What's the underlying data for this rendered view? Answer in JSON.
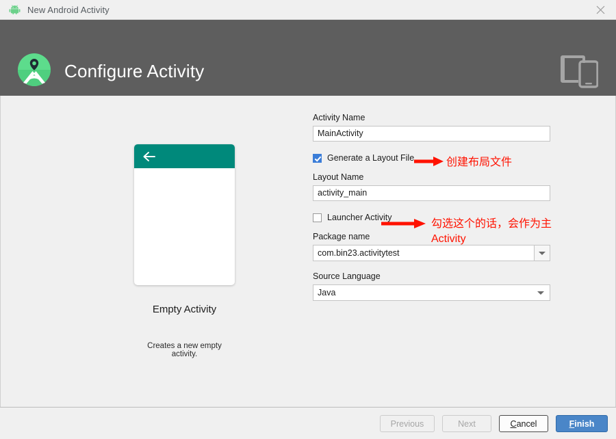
{
  "window": {
    "title": "New Android Activity",
    "android_icon": "android-robot-icon",
    "close_icon": "close-icon"
  },
  "header": {
    "title": "Configure Activity",
    "logo_icon": "android-studio-logo-icon",
    "device_icon": "tablet-and-phone-icon"
  },
  "preview": {
    "back_icon": "back-arrow-icon",
    "template_name": "Empty Activity",
    "description": "Creates a new empty activity.",
    "accent_color": "#00897b"
  },
  "form": {
    "activity_name": {
      "label": "Activity Name",
      "value": "MainActivity"
    },
    "generate_layout": {
      "label": "Generate a Layout File",
      "checked": true
    },
    "layout_name": {
      "label": "Layout Name",
      "value": "activity_main"
    },
    "launcher_activity": {
      "label": "Launcher Activity",
      "checked": false
    },
    "package_name": {
      "label": "Package name",
      "value": "com.bin23.activitytest",
      "dropdown_icon": "chevron-down-icon"
    },
    "source_language": {
      "label": "Source Language",
      "value": "Java",
      "dropdown_icon": "chevron-down-icon"
    }
  },
  "annotations": {
    "color": "#ff1200",
    "generate_layout_note": "创建布局文件",
    "launcher_activity_note": "勾选这个的话，会作为主\nActivity",
    "arrow_icon": "red-arrow-icon"
  },
  "footer": {
    "previous": "Previous",
    "next": "Next",
    "cancel_prefix": "",
    "cancel_mnemonic": "C",
    "cancel_suffix": "ancel",
    "finish_mnemonic": "F",
    "finish_suffix": "inish",
    "primary_color": "#4a86c8"
  }
}
